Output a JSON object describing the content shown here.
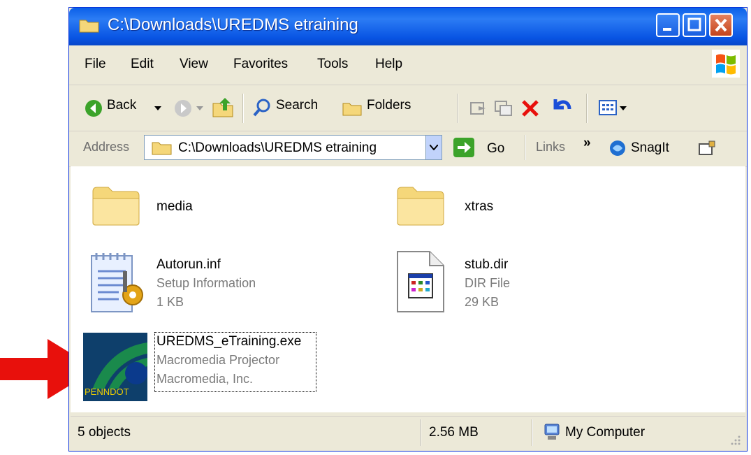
{
  "window": {
    "title": "C:\\Downloads\\UREDMS etraining",
    "minimize_icon": "minimize-icon",
    "maximize_icon": "maximize-icon",
    "close_icon": "close-icon"
  },
  "menu": [
    "File",
    "Edit",
    "View",
    "Favorites",
    "Tools",
    "Help"
  ],
  "toolbar": {
    "back_label": "Back",
    "search_label": "Search",
    "folders_label": "Folders"
  },
  "address": {
    "label": "Address",
    "value": "C:\\Downloads\\UREDMS etraining",
    "go_label": "Go",
    "links_label": "Links",
    "links_chevron": "»",
    "snagit_label": "SnagIt"
  },
  "files": [
    {
      "name": "media"
    },
    {
      "name": "xtras"
    },
    {
      "name": "Autorun.inf",
      "type": "Setup Information",
      "size": "1 KB"
    },
    {
      "name": "stub.dir",
      "type": "DIR File",
      "size": "29 KB"
    },
    {
      "name": "UREDMS_eTraining.exe",
      "type": "Macromedia Projector",
      "company": "Macromedia, Inc.",
      "icon_text": "PENNDOT"
    }
  ],
  "status": {
    "objects": "5 objects",
    "size": "2.56 MB",
    "location": "My Computer"
  },
  "colors": {
    "titlebar": "#0A5FE8",
    "close": "#D9512C",
    "arrow": "#E8100C",
    "folder": "#F5D77A"
  }
}
